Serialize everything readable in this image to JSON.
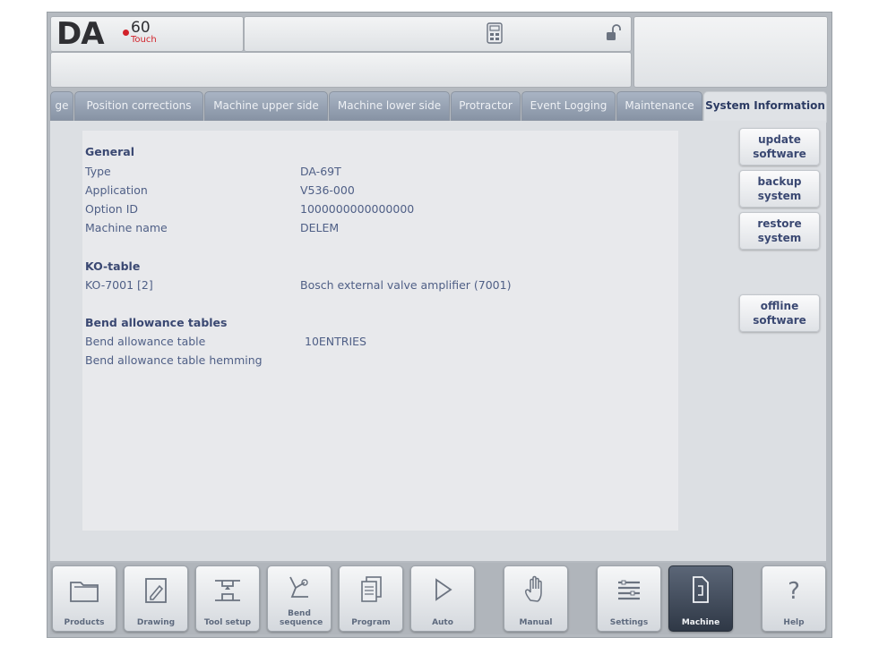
{
  "header": {
    "logo_main": "DA",
    "logo_model": "60",
    "logo_sub": "Touch"
  },
  "tabs": [
    {
      "label": "ge",
      "active": false
    },
    {
      "label": "Position corrections",
      "active": false
    },
    {
      "label": "Machine upper side",
      "active": false
    },
    {
      "label": "Machine lower side",
      "active": false
    },
    {
      "label": "Protractor",
      "active": false
    },
    {
      "label": "Event Logging",
      "active": false
    },
    {
      "label": "Maintenance",
      "active": false
    },
    {
      "label": "System Information",
      "active": true
    }
  ],
  "general": {
    "title": "General",
    "rows": [
      {
        "label": "Type",
        "value": "DA-69T"
      },
      {
        "label": "Application",
        "value": "V536-000"
      },
      {
        "label": "Option ID",
        "value": "1000000000000000"
      },
      {
        "label": "Machine name",
        "value": "DELEM"
      }
    ]
  },
  "ko_table": {
    "title": "KO-table",
    "rows": [
      {
        "label": "KO-7001 [2]",
        "value": "Bosch external valve amplifier (7001)"
      }
    ]
  },
  "bend_tables": {
    "title": "Bend allowance tables",
    "rows": [
      {
        "label": "Bend allowance table",
        "value": "10ENTRIES"
      },
      {
        "label": "Bend allowance table hemming",
        "value": ""
      }
    ]
  },
  "side_buttons": [
    {
      "line1": "update",
      "line2": "software"
    },
    {
      "line1": "backup",
      "line2": "system"
    },
    {
      "line1": "restore",
      "line2": "system"
    },
    {
      "line1": "offline",
      "line2": "software"
    }
  ],
  "nav": [
    {
      "label": "Products",
      "icon": "folder-icon",
      "active": false
    },
    {
      "label": "Drawing",
      "icon": "pencil-icon",
      "active": false
    },
    {
      "label": "Tool setup",
      "icon": "tool-icon",
      "active": false
    },
    {
      "label": "Bend sequence",
      "icon": "bend-sequence-icon",
      "active": false
    },
    {
      "label": "Program",
      "icon": "pages-icon",
      "active": false
    },
    {
      "label": "Auto",
      "icon": "play-icon",
      "active": false
    },
    {
      "label": "Manual",
      "icon": "hand-icon",
      "active": false
    },
    {
      "label": "Settings",
      "icon": "settings-icon",
      "active": false
    },
    {
      "label": "Machine",
      "icon": "machine-icon",
      "active": true
    },
    {
      "label": "Help",
      "icon": "help-icon",
      "active": false
    }
  ],
  "colors": {
    "accent_red": "#d2222a",
    "text_blue": "#3a4872",
    "tab_inactive": "#8793a5",
    "active_nav": "#2f3846"
  }
}
